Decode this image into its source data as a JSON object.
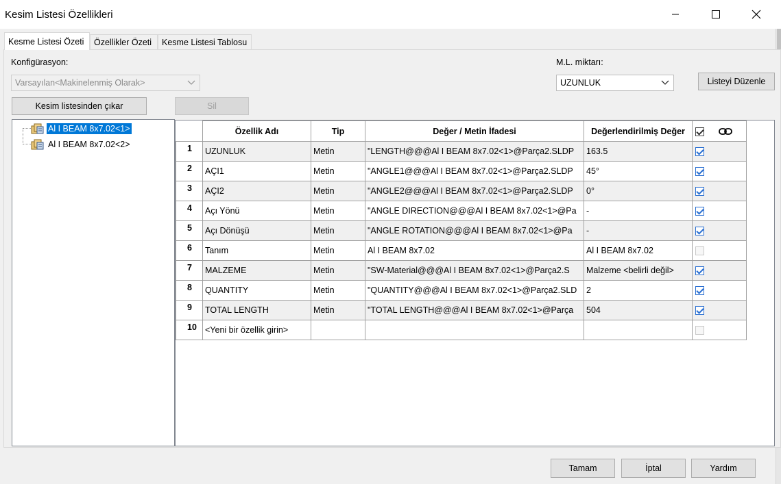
{
  "window": {
    "title": "Kesim Listesi Özellikleri"
  },
  "tabs": [
    {
      "label": "Kesme Listesi Özeti",
      "active": true
    },
    {
      "label": "Özellikler Özeti",
      "active": false
    },
    {
      "label": "Kesme Listesi Tablosu",
      "active": false
    }
  ],
  "config": {
    "label": "Konfigürasyon:",
    "value": "Varsayılan<Makinelenmiş Olarak>"
  },
  "ml": {
    "label": "M.L. miktarı:",
    "value": "UZUNLUK"
  },
  "buttons": {
    "edit_list": "Listeyi Düzenle",
    "remove_from_list": "Kesim listesinden çıkar",
    "delete": "Sil",
    "ok": "Tamam",
    "cancel": "İptal",
    "help": "Yardım"
  },
  "tree": {
    "items": [
      {
        "label": "Al I BEAM 8x7.02<1>",
        "selected": true
      },
      {
        "label": "Al I BEAM 8x7.02<2>",
        "selected": false
      }
    ]
  },
  "table": {
    "headers": [
      "Özellik Adı",
      "Tip",
      "Değer / Metin İfadesi",
      "Değerlendirilmiş Değer"
    ],
    "rows": [
      {
        "num": "1",
        "name": "UZUNLUK",
        "type": "Metin",
        "expr": "\"LENGTH@@@Al I BEAM 8x7.02<1>@Parça2.SLDP",
        "value": "163.5",
        "checked": true
      },
      {
        "num": "2",
        "name": "AÇI1",
        "type": "Metin",
        "expr": "\"ANGLE1@@@Al I BEAM 8x7.02<1>@Parça2.SLDP",
        "value": "45°",
        "checked": true
      },
      {
        "num": "3",
        "name": "AÇI2",
        "type": "Metin",
        "expr": "\"ANGLE2@@@Al I BEAM 8x7.02<1>@Parça2.SLDP",
        "value": "0°",
        "checked": true
      },
      {
        "num": "4",
        "name": "Açı Yönü",
        "type": "Metin",
        "expr": "\"ANGLE DIRECTION@@@Al I BEAM 8x7.02<1>@Pa",
        "value": "-",
        "checked": true
      },
      {
        "num": "5",
        "name": "Açı Dönüşü",
        "type": "Metin",
        "expr": "\"ANGLE ROTATION@@@Al I BEAM 8x7.02<1>@Pa",
        "value": "-",
        "checked": true
      },
      {
        "num": "6",
        "name": "Tanım",
        "type": "Metin",
        "expr": "Al I BEAM 8x7.02",
        "value": "Al I BEAM 8x7.02",
        "checked": false
      },
      {
        "num": "7",
        "name": "MALZEME",
        "type": "Metin",
        "expr": "\"SW-Material@@@Al I BEAM 8x7.02<1>@Parça2.S",
        "value": "Malzeme <belirli değil>",
        "checked": true
      },
      {
        "num": "8",
        "name": "QUANTITY",
        "type": "Metin",
        "expr": "\"QUANTITY@@@Al I BEAM 8x7.02<1>@Parça2.SLD",
        "value": "2",
        "checked": true
      },
      {
        "num": "9",
        "name": "TOTAL LENGTH",
        "type": "Metin",
        "expr": "\"TOTAL LENGTH@@@Al I BEAM 8x7.02<1>@Parça",
        "value": "504",
        "checked": true
      },
      {
        "num": "10",
        "name": "<Yeni bir özellik girin>",
        "type": "",
        "expr": "",
        "value": "",
        "checked": false
      }
    ]
  },
  "icons": {
    "minimize": "minimize-icon",
    "maximize": "maximize-icon",
    "close": "close-icon",
    "link": "link-icon",
    "tree_item": "cut-list-item-icon"
  },
  "colors": {
    "selection": "#0078d7",
    "checkbox": "#2a6fd1"
  }
}
